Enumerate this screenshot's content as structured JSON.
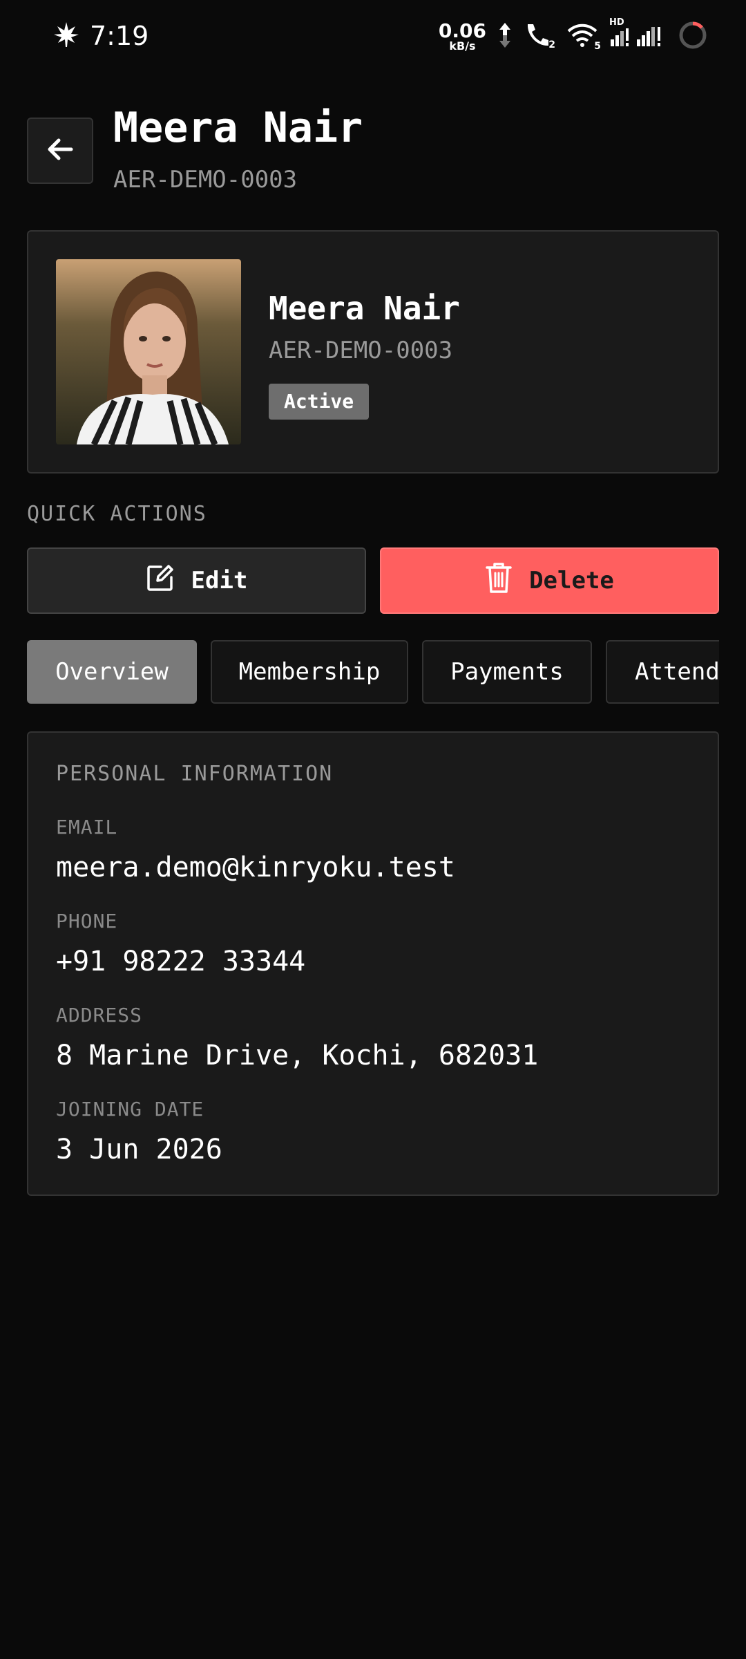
{
  "status_bar": {
    "time": "7:19",
    "net_speed_value": "0.06",
    "net_speed_unit": "kB/s",
    "call_badge": "2",
    "wifi_badge": "5",
    "hd_label": "HD"
  },
  "header": {
    "title": "Meera Nair",
    "subtitle": "AER-DEMO-0003"
  },
  "profile": {
    "name": "Meera Nair",
    "member_id": "AER-DEMO-0003",
    "status": "Active"
  },
  "quick_actions": {
    "label": "QUICK ACTIONS",
    "edit_label": "Edit",
    "delete_label": "Delete"
  },
  "tabs": [
    {
      "label": "Overview",
      "active": true
    },
    {
      "label": "Membership",
      "active": false
    },
    {
      "label": "Payments",
      "active": false
    },
    {
      "label": "Attendance",
      "active": false
    }
  ],
  "personal_info": {
    "title": "PERSONAL INFORMATION",
    "fields": [
      {
        "label": "EMAIL",
        "value": "meera.demo@kinryoku.test"
      },
      {
        "label": "PHONE",
        "value": "+91 98222 33344"
      },
      {
        "label": "ADDRESS",
        "value": "8 Marine Drive, Kochi, 682031"
      },
      {
        "label": "JOINING DATE",
        "value": "3 Jun 2026"
      }
    ]
  },
  "colors": {
    "background": "#0a0a0a",
    "card": "#1a1a1a",
    "delete_accent": "#ff5f5f",
    "active_tab": "#7a7a7a"
  }
}
